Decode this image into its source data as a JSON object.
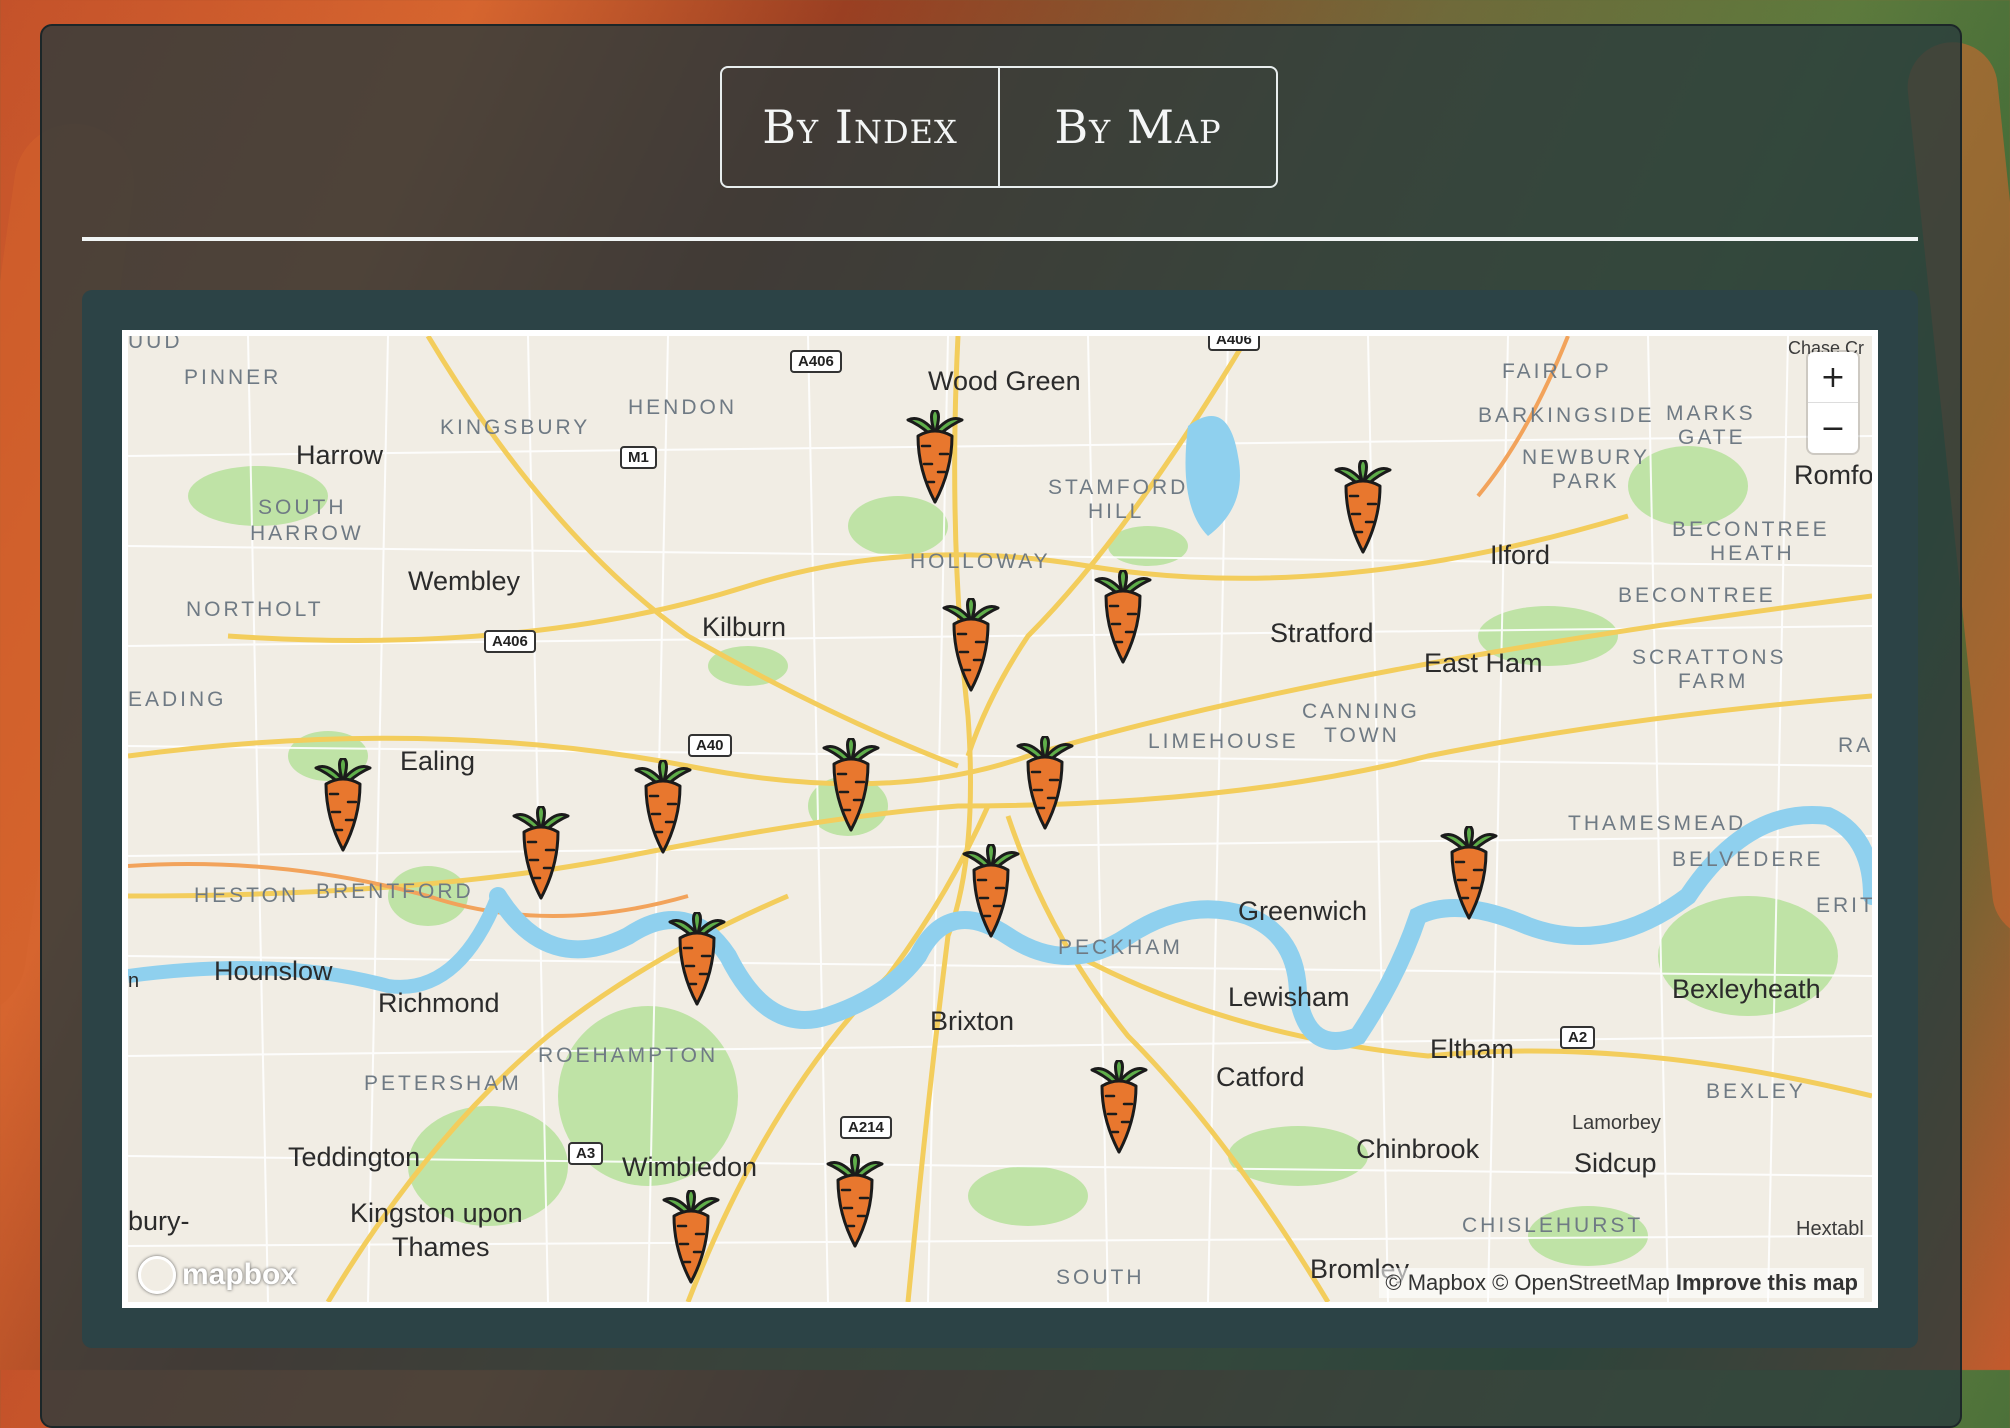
{
  "tabs": [
    {
      "label": "By Index"
    },
    {
      "label": "By Map"
    }
  ],
  "map": {
    "zoom_in_label": "+",
    "zoom_out_label": "−",
    "logo_text": "mapbox",
    "attribution": "© Mapbox © OpenStreetMap",
    "improve_link": "Improve this map",
    "place_labels": [
      {
        "text": "Wood Green",
        "kind": "big"
      },
      {
        "text": "Harrow",
        "kind": "big"
      },
      {
        "text": "Wembley",
        "kind": "big"
      },
      {
        "text": "Kilburn",
        "kind": "big"
      },
      {
        "text": "Ealing",
        "kind": "big"
      },
      {
        "text": "Stratford",
        "kind": "big"
      },
      {
        "text": "East Ham",
        "kind": "big"
      },
      {
        "text": "Ilford",
        "kind": "big"
      },
      {
        "text": "Romfo",
        "kind": "big"
      },
      {
        "text": "Greenwich",
        "kind": "big"
      },
      {
        "text": "Lewisham",
        "kind": "big"
      },
      {
        "text": "Brixton",
        "kind": "big"
      },
      {
        "text": "Hounslow",
        "kind": "big"
      },
      {
        "text": "Richmond",
        "kind": "big"
      },
      {
        "text": "Catford",
        "kind": "big"
      },
      {
        "text": "Eltham",
        "kind": "big"
      },
      {
        "text": "Bexleyheath",
        "kind": "big"
      },
      {
        "text": "Teddington",
        "kind": "big"
      },
      {
        "text": "Wimbledon",
        "kind": "big"
      },
      {
        "text": "Chinbrook",
        "kind": "big"
      },
      {
        "text": "Sidcup",
        "kind": "big"
      },
      {
        "text": "Kingston upon",
        "kind": "big"
      },
      {
        "text": "Thames",
        "kind": "big"
      },
      {
        "text": "Bromley",
        "kind": "big"
      },
      {
        "text": "Lamorbey",
        "kind": "small"
      },
      {
        "text": "Hextabl",
        "kind": "small"
      },
      {
        "text": "Chase Cr",
        "kind": "small"
      },
      {
        "text": "PINNER",
        "kind": "dist"
      },
      {
        "text": "KINGSBURY",
        "kind": "dist"
      },
      {
        "text": "HENDON",
        "kind": "dist"
      },
      {
        "text": "SOUTH",
        "kind": "dist"
      },
      {
        "text": "HARROW",
        "kind": "dist"
      },
      {
        "text": "NORTHOLT",
        "kind": "dist"
      },
      {
        "text": "EADING",
        "kind": "dist"
      },
      {
        "text": "STAMFORD",
        "kind": "dist"
      },
      {
        "text": "HILL",
        "kind": "dist"
      },
      {
        "text": "HOLLOWAY",
        "kind": "dist"
      },
      {
        "text": "FAIRLOP",
        "kind": "dist"
      },
      {
        "text": "BARKINGSIDE",
        "kind": "dist"
      },
      {
        "text": "MARKS",
        "kind": "dist"
      },
      {
        "text": "GATE",
        "kind": "dist"
      },
      {
        "text": "NEWBURY",
        "kind": "dist"
      },
      {
        "text": "PARK",
        "kind": "dist"
      },
      {
        "text": "BECONTREE",
        "kind": "dist"
      },
      {
        "text": "HEATH",
        "kind": "dist"
      },
      {
        "text": "BECONTREE",
        "kind": "dist"
      },
      {
        "text": "SCRATTONS",
        "kind": "dist"
      },
      {
        "text": "FARM",
        "kind": "dist"
      },
      {
        "text": "CANNING",
        "kind": "dist"
      },
      {
        "text": "TOWN",
        "kind": "dist"
      },
      {
        "text": "LIMEHOUSE",
        "kind": "dist"
      },
      {
        "text": "THAMESMEAD",
        "kind": "dist"
      },
      {
        "text": "BELVEDERE",
        "kind": "dist"
      },
      {
        "text": "ERITI",
        "kind": "dist"
      },
      {
        "text": "RA",
        "kind": "dist"
      },
      {
        "text": "HESTON",
        "kind": "dist"
      },
      {
        "text": "BRENTFORD",
        "kind": "dist"
      },
      {
        "text": "PECKHAM",
        "kind": "dist"
      },
      {
        "text": "ROEHAMPTON",
        "kind": "dist"
      },
      {
        "text": "PETERSHAM",
        "kind": "dist"
      },
      {
        "text": "BEXLEY",
        "kind": "dist"
      },
      {
        "text": "CHISLEHURST",
        "kind": "dist"
      },
      {
        "text": "SOUTH",
        "kind": "dist"
      },
      {
        "text": "UUD",
        "kind": "dist"
      },
      {
        "text": "bury-",
        "kind": "big"
      },
      {
        "text": "n",
        "kind": "big"
      }
    ],
    "road_labels": [
      "A406",
      "A406",
      "M1",
      "A406",
      "A40",
      "A214",
      "A3",
      "A2"
    ],
    "marker_icon": "carrot-icon",
    "marker_count": 15
  },
  "colors": {
    "panel": "#283a3c",
    "water": "#8fd0ee",
    "park": "#b8e0a0",
    "major_road": "#f4cf5e",
    "carrot": "#e8772e",
    "carrot_leaf": "#5fae4a"
  }
}
